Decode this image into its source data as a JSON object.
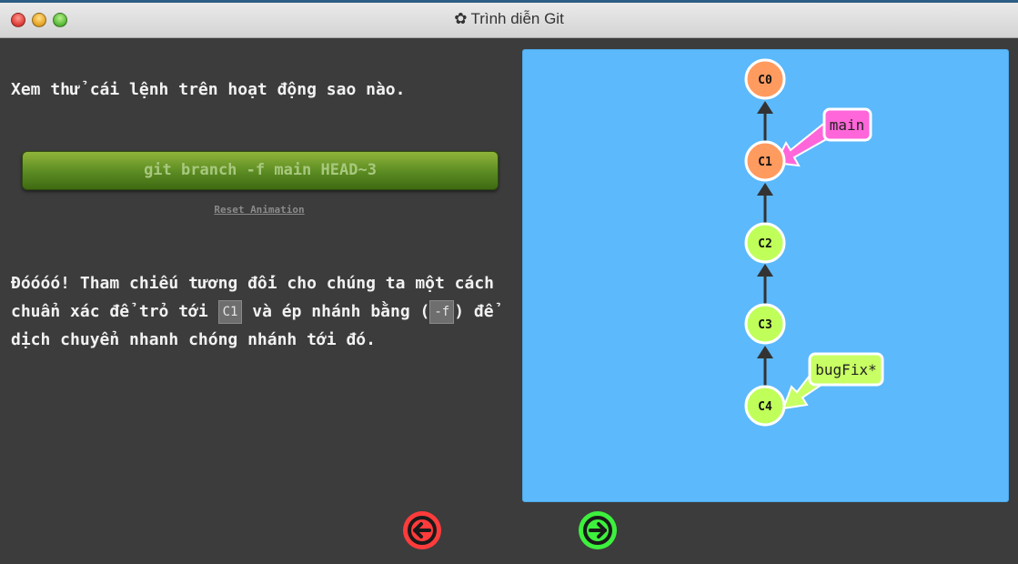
{
  "window": {
    "title": "Trình diễn Git",
    "title_icon": "gear-icon"
  },
  "lesson": {
    "intro": "Xem thử cái lệnh trên hoạt động sao nào.",
    "command": "git branch -f main HEAD~3",
    "reset_label": "Reset Animation",
    "desc_part1": "Đóóóó! Tham chiếu tương đối cho chúng ta một cách chuẩn xác để trỏ tới ",
    "desc_code1": "C1",
    "desc_part2": " và ép nhánh bằng (",
    "desc_code2": "-f",
    "desc_part3": ") để dịch chuyển nhanh chóng nhánh tới đó."
  },
  "graph": {
    "commits": [
      {
        "id": "C0",
        "color": "#ff9b5f"
      },
      {
        "id": "C1",
        "color": "#ff9b5f"
      },
      {
        "id": "C2",
        "color": "#c0ff5a"
      },
      {
        "id": "C3",
        "color": "#c0ff5a"
      },
      {
        "id": "C4",
        "color": "#c0ff5a"
      }
    ],
    "branches": [
      {
        "name": "main",
        "target": "C1",
        "color": "#ff66d9"
      },
      {
        "name": "bugFix*",
        "target": "C4",
        "color": "#c8ff64"
      }
    ]
  },
  "nav": {
    "back_icon": "left-arrow-icon",
    "forward_icon": "right-arrow-icon",
    "back_color": "#ff3b3b",
    "forward_color": "#3df03d"
  }
}
